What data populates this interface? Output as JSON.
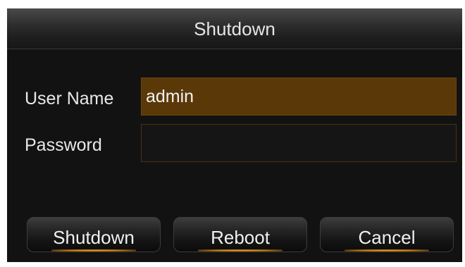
{
  "dialog": {
    "title": "Shutdown",
    "user_name_label": "User Name",
    "user_name_value": "admin",
    "password_label": "Password",
    "password_value": ""
  },
  "buttons": {
    "shutdown_label": "Shutdown",
    "reboot_label": "Reboot",
    "cancel_label": "Cancel"
  },
  "colors": {
    "background": "#121212",
    "focused_field": "#5a3808",
    "button_glow": "#f0a01a"
  }
}
